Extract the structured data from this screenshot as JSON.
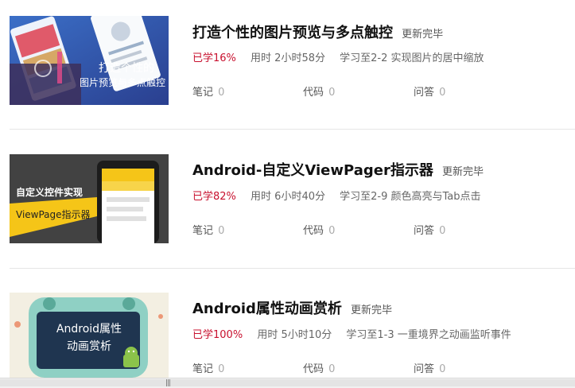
{
  "courses": [
    {
      "title": "打造个性的图片预览与多点触控",
      "badge": "更新完毕",
      "progress": "已学16%",
      "duration": "用时 2小时58分",
      "last_lesson": "学习至2-2 实现图片的居中缩放",
      "notes_label": "笔记",
      "notes_count": "0",
      "code_label": "代码",
      "code_count": "0",
      "qa_label": "问答",
      "qa_count": "0",
      "thumb_text_1": "打造个性的",
      "thumb_text_2": "图片预览与多点触控"
    },
    {
      "title": "Android-自定义ViewPager指示器",
      "badge": "更新完毕",
      "progress": "已学82%",
      "duration": "用时 6小时40分",
      "last_lesson": "学习至2-9 颜色高亮与Tab点击",
      "notes_label": "笔记",
      "notes_count": "0",
      "code_label": "代码",
      "code_count": "0",
      "qa_label": "问答",
      "qa_count": "0",
      "thumb_text_1": "自定义控件实现",
      "thumb_text_2": "ViewPage指示器"
    },
    {
      "title": "Android属性动画赏析",
      "badge": "更新完毕",
      "progress": "已学100%",
      "duration": "用时 5小时10分",
      "last_lesson": "学习至1-3 一重境界之动画监听事件",
      "notes_label": "笔记",
      "notes_count": "0",
      "code_label": "代码",
      "code_count": "0",
      "qa_label": "问答",
      "qa_count": "0",
      "thumb_text_1": "Android属性",
      "thumb_text_2": "动画赏析"
    }
  ],
  "colors": {
    "progress": "#c8102e",
    "android_green": "#8bc34a",
    "viewpager_yellow": "#f5c518"
  }
}
